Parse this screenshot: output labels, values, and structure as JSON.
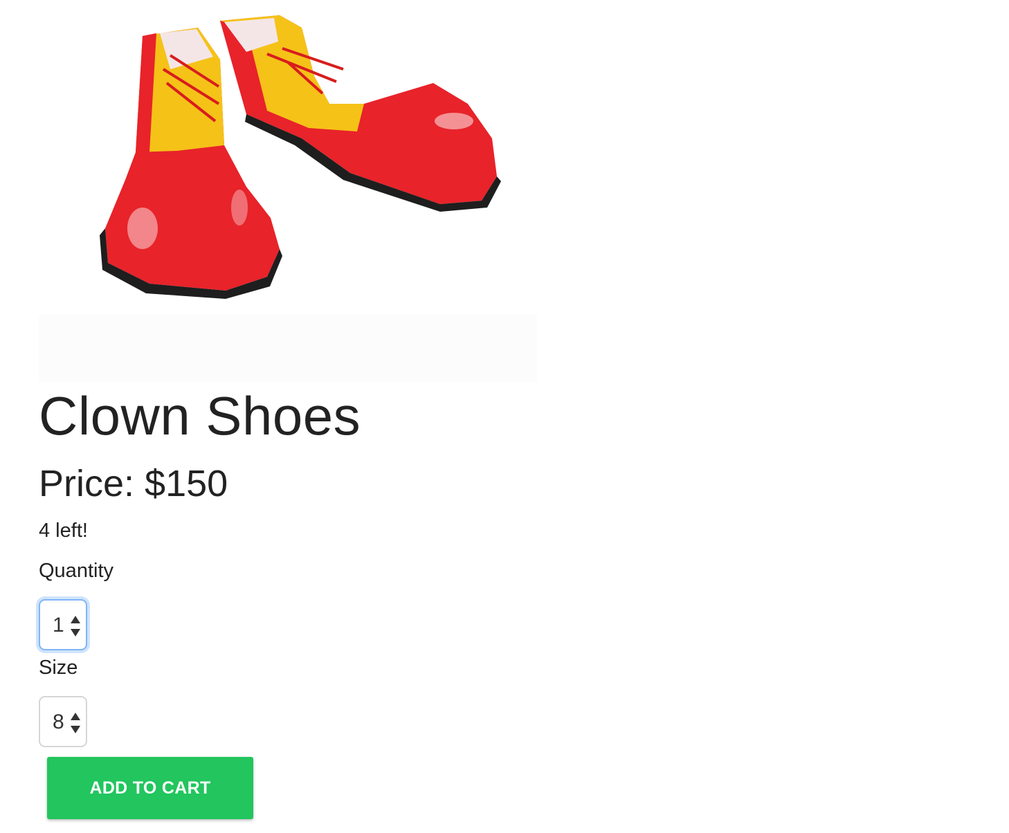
{
  "product": {
    "image": {
      "icon": "clown-shoes-image"
    },
    "title": "Clown Shoes",
    "price_label": "Price: $150",
    "stock_text": "4 left!",
    "quantity": {
      "label": "Quantity",
      "value": "1",
      "icon": "stepper-arrows-icon"
    },
    "size": {
      "label": "Size",
      "value": "8",
      "icon": "stepper-arrows-icon"
    },
    "add_to_cart_label": "ADD TO CART"
  },
  "colors": {
    "button_bg": "#22c55e",
    "button_text": "#ffffff",
    "focus_ring": "#7fb6f5",
    "shoe_red": "#e8232a",
    "shoe_yellow": "#f5c218"
  }
}
